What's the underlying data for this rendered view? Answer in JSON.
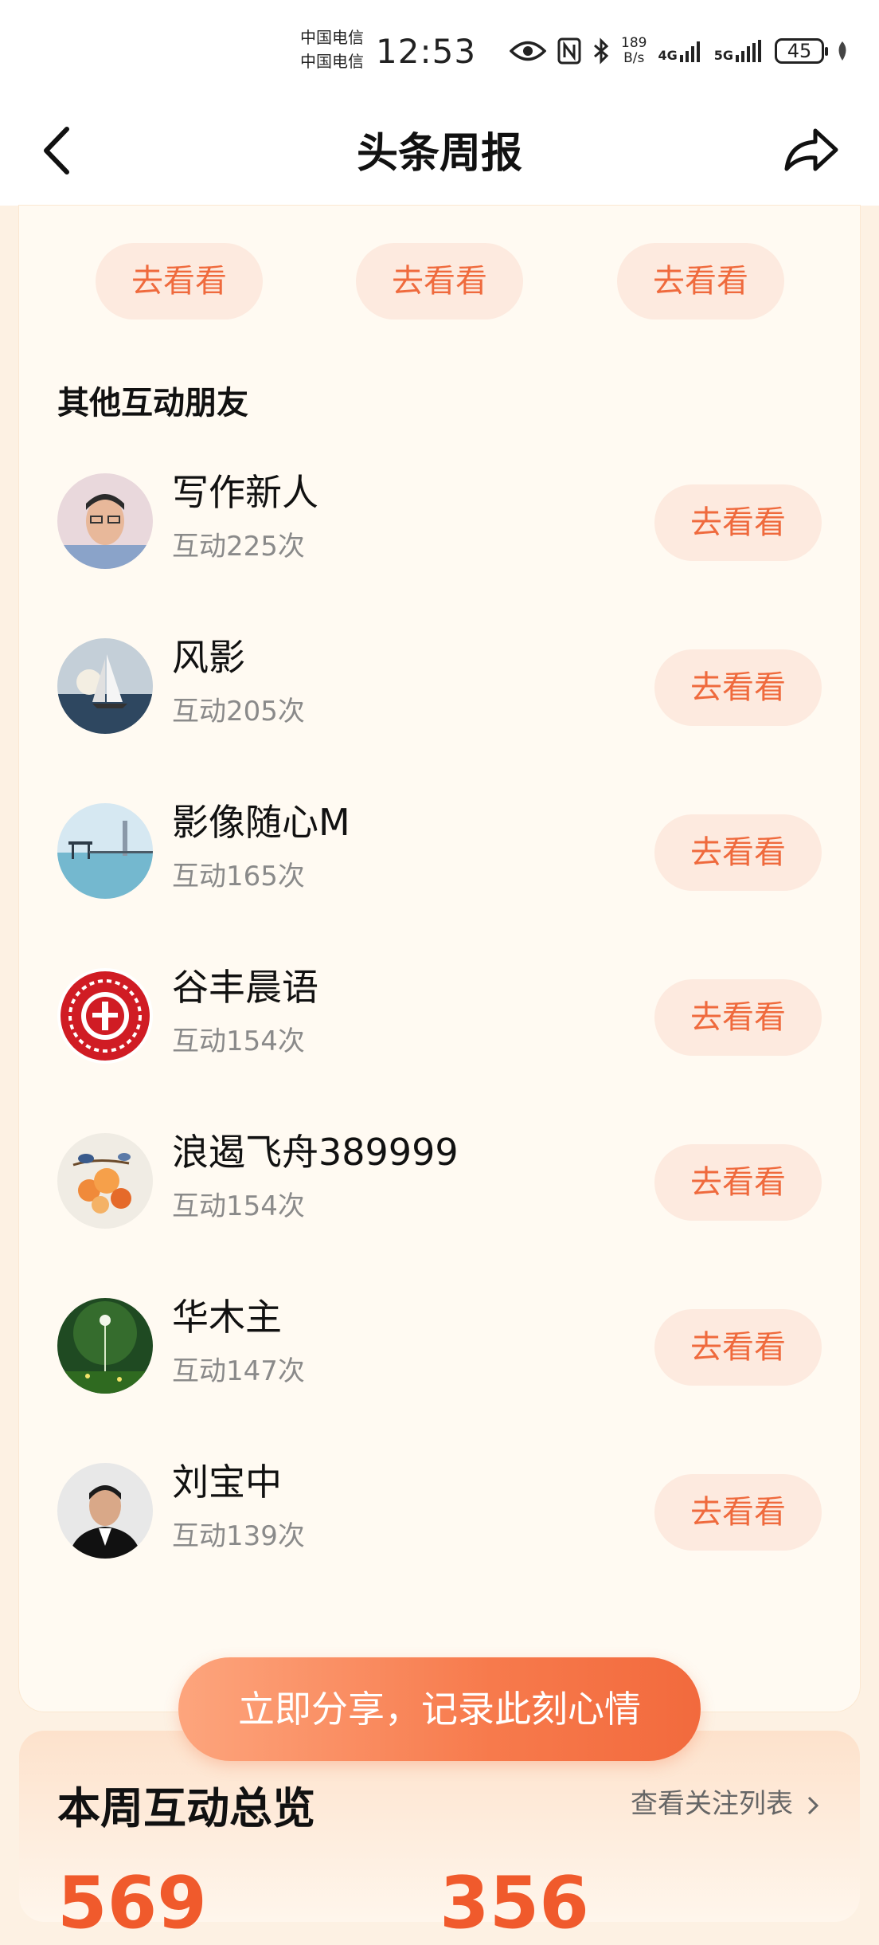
{
  "status_bar": {
    "carrier_1": "中国电信",
    "carrier_2": "中国电信",
    "time": "12:53",
    "net_speed_value": "189",
    "net_speed_unit": "B/s",
    "sig1": "4G",
    "sig2": "5G",
    "battery": "45"
  },
  "nav": {
    "title": "头条周报"
  },
  "top_buttons": [
    "去看看",
    "去看看",
    "去看看"
  ],
  "section_title": "其他互动朋友",
  "friends": [
    {
      "name": "写作新人",
      "count": "互动225次",
      "button": "去看看"
    },
    {
      "name": "风影",
      "count": "互动205次",
      "button": "去看看"
    },
    {
      "name": "影像随心M",
      "count": "互动165次",
      "button": "去看看"
    },
    {
      "name": "谷丰晨语",
      "count": "互动154次",
      "button": "去看看"
    },
    {
      "name": "浪遏飞舟389999",
      "count": "互动154次",
      "button": "去看看"
    },
    {
      "name": "华木主",
      "count": "互动147次",
      "button": "去看看"
    },
    {
      "name": "刘宝中",
      "count": "互动139次",
      "button": "去看看"
    }
  ],
  "share_button": "立即分享，记录此刻心情",
  "overview": {
    "title": "本周互动总览",
    "follow_link": "查看关注列表",
    "num1": "569",
    "num2": "356"
  },
  "colors": {
    "accent": "#ef6a3d",
    "button_bg": "#fdeadf",
    "card_bg": "#fffaf2",
    "page_bg": "#fdf1e3"
  }
}
